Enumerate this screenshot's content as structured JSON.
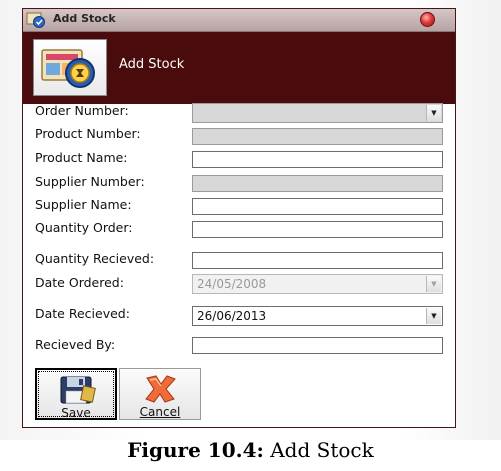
{
  "window": {
    "title": "Add Stock",
    "header_title": "Add Stock"
  },
  "form": {
    "order_number": {
      "label": "Order Number:",
      "value": ""
    },
    "product_number": {
      "label": "Product Number:",
      "value": ""
    },
    "product_name": {
      "label": "Product Name:",
      "value": ""
    },
    "supplier_number": {
      "label": "Supplier Number:",
      "value": ""
    },
    "supplier_name": {
      "label": "Supplier Name:",
      "value": ""
    },
    "quantity_order": {
      "label": "Quantity Order:",
      "value": ""
    },
    "quantity_received": {
      "label": "Quantity Recieved:",
      "value": ""
    },
    "date_ordered": {
      "label": "Date Ordered:",
      "value": "24/05/2008"
    },
    "date_received": {
      "label": "Date Recieved:",
      "value": "26/06/2013"
    },
    "received_by": {
      "label": "Recieved By:",
      "value": ""
    }
  },
  "buttons": {
    "save": "Save",
    "cancel": "Cancel"
  },
  "caption": {
    "prefix": "Figure 10.4:",
    "text": " Add Stock"
  },
  "colors": {
    "header_bg": "#490b0b",
    "window_border": "#4a1515",
    "close_button": "#e03a3a"
  },
  "icons": {
    "window": "add-stock-icon",
    "close": "close-icon",
    "header": "add-stock-icon",
    "save": "floppy-disk-icon",
    "cancel": "cancel-x-icon",
    "dropdown": "dropdown-arrow-icon"
  }
}
